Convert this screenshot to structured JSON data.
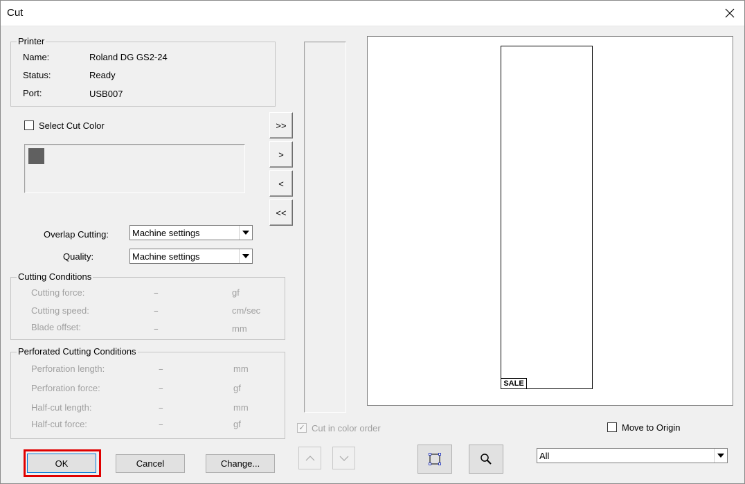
{
  "window": {
    "title": "Cut"
  },
  "printer": {
    "group_label": "Printer",
    "name_label": "Name:",
    "name_value": "Roland DG GS2-24",
    "status_label": "Status:",
    "status_value": "Ready",
    "port_label": "Port:",
    "port_value": "USB007"
  },
  "select_cut_color": {
    "label": "Select Cut Color",
    "checked": false
  },
  "color_swatch": "#606060",
  "transfer_buttons": {
    "all_right": ">>",
    "right": ">",
    "left": "<",
    "all_left": "<<"
  },
  "overlap_cutting": {
    "label": "Overlap Cutting:",
    "value": "Machine settings"
  },
  "quality": {
    "label": "Quality:",
    "value": "Machine settings"
  },
  "cutting_conditions": {
    "group_label": "Cutting Conditions",
    "rows": [
      {
        "label": "Cutting force:",
        "value": "--",
        "unit": "gf"
      },
      {
        "label": "Cutting speed:",
        "value": "--",
        "unit": "cm/sec"
      },
      {
        "label": "Blade offset:",
        "value": "--",
        "unit": "mm"
      }
    ]
  },
  "perforated_conditions": {
    "group_label": "Perforated Cutting Conditions",
    "rows": [
      {
        "label": "Perforation length:",
        "value": "--",
        "unit": "mm"
      },
      {
        "label": "Perforation  force:",
        "value": "--",
        "unit": "gf"
      },
      {
        "label": "Half-cut length:",
        "value": "--",
        "unit": "mm"
      },
      {
        "label": "Half-cut force:",
        "value": "--",
        "unit": "gf"
      }
    ]
  },
  "cut_in_color_order": {
    "label": "Cut in color order",
    "checked": true
  },
  "move_to_origin": {
    "label": "Move to Origin",
    "checked": false
  },
  "preview": {
    "sale_text": "SALE"
  },
  "buttons": {
    "ok": "OK",
    "cancel": "Cancel",
    "change": "Change..."
  },
  "view_select": {
    "value": "All"
  },
  "accent": {
    "highlight": "#e00000"
  }
}
